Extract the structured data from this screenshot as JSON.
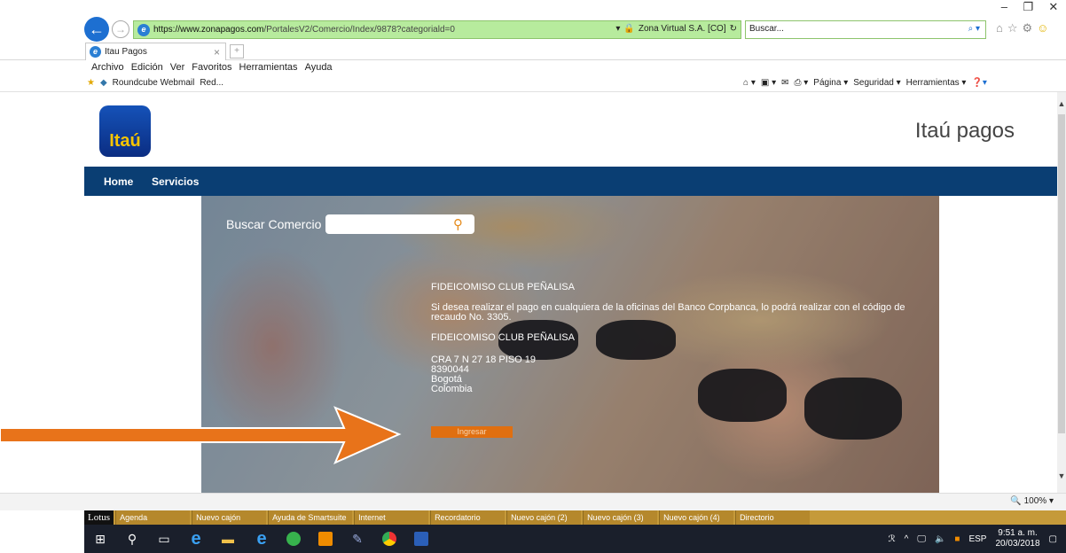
{
  "window": {
    "minimize": "–",
    "restore": "❐",
    "close": "✕"
  },
  "browser": {
    "url_prefix": "https://",
    "url_domain": "www.zonapagos.com",
    "url_path": "/PortalesV2/Comercio/Index/9878?categoriald=0",
    "cert": "Zona Virtual S.A. [CO]",
    "search_placeholder": "Buscar...",
    "tab_title": "Itau Pagos",
    "menu": [
      "Archivo",
      "Edición",
      "Ver",
      "Favoritos",
      "Herramientas",
      "Ayuda"
    ],
    "favorites": [
      "Roundcube Webmail",
      "Red..."
    ],
    "command_bar": [
      "Página ▾",
      "Seguridad ▾",
      "Herramientas ▾"
    ],
    "zoom": "100%"
  },
  "site": {
    "logo_text": "Itaú",
    "name": "Itaú pagos",
    "nav": [
      "Home",
      "Servicios"
    ],
    "search_label": "Buscar Comercio",
    "info": {
      "title": "FIDEICOMISO CLUB PEÑALISA",
      "message": "Si desea realizar el pago en cualquiera de la oficinas del Banco Corpbanca, lo podrá realizar con el código de recaudo No. 3305.",
      "title2": "FIDEICOMISO CLUB PEÑALISA",
      "address": "CRA 7 N 27 18 PISO 19",
      "phone": "8390044",
      "city": "Bogotá",
      "country": "Colombia"
    },
    "button": "Ingresar"
  },
  "lotus": {
    "logo": "Lotus",
    "items": [
      "Agenda",
      "Nuevo cajón",
      "Ayuda de Smartsuite",
      "Internet",
      "Recordatorio",
      "Nuevo cajón (2)",
      "Nuevo cajón (3)",
      "Nuevo cajón (4)",
      "Directorio"
    ]
  },
  "taskbar": {
    "lang": "ESP",
    "time": "9:51 a. m.",
    "date": "20/03/2018"
  },
  "colors": {
    "navbar": "#0a3e73",
    "accent": "#e06f10",
    "address_bar": "#b7eb9d",
    "annotation_arrow": "#e8731a"
  }
}
